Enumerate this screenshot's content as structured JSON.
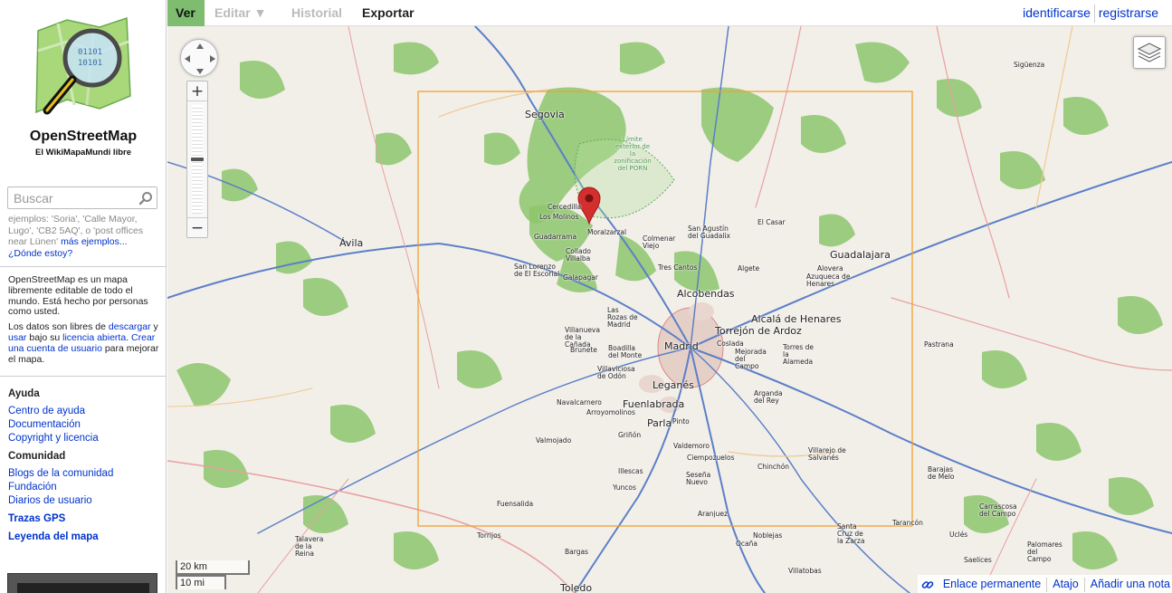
{
  "sidebar": {
    "site_title": "OpenStreetMap",
    "site_subtitle": "El WikiMapaMundi libre",
    "search": {
      "placeholder": "Buscar",
      "examples_prefix": "ejemplos: 'Soria', 'Calle Mayor, Lugo', 'CB2 5AQ', o 'post offices near Lünen'",
      "more_examples": "más ejemplos...",
      "where_am_i": "¿Dónde estoy?"
    },
    "about": {
      "p1": "OpenStreetMap es un mapa libremente editable de todo el mundo. Está hecho por personas como usted.",
      "p2_a": "Los datos son libres de ",
      "p2_download": "descargar",
      "p2_b": " y ",
      "p2_use": "usar",
      "p2_c": " bajo su ",
      "p2_license": "licencia abierta",
      "p2_d": ". ",
      "p2_create": "Crear una cuenta de usuario",
      "p2_e": " para mejorar el mapa."
    },
    "help": {
      "title": "Ayuda",
      "links": [
        "Centro de ayuda",
        "Documentación",
        "Copyright y licencia"
      ]
    },
    "community": {
      "title": "Comunidad",
      "links": [
        "Blogs de la comunidad",
        "Fundación",
        "Diarios de usuario"
      ]
    },
    "gps_traces": "Trazas GPS",
    "map_key": "Leyenda del mapa"
  },
  "topbar": {
    "tabs": [
      "Ver",
      "Editar ▼",
      "Historial",
      "Exportar"
    ],
    "login": "identificarse",
    "signup": "registrarse"
  },
  "map": {
    "scale_km": "20 km",
    "scale_mi": "10 mi",
    "footer": {
      "permalink": "Enlace permanente",
      "shortlink": "Atajo",
      "add_note": "Añadir una nota"
    },
    "labels": {
      "segovia": "Segovia",
      "avila": "Ávila",
      "guadalajara": "Guadalajara",
      "madrid": "Madrid",
      "alcobendas": "Alcobendas",
      "alcala": "Alcalá de Henares",
      "torrejon": "Torrejón de Ardoz",
      "leganes": "Leganés",
      "fuenlabrada": "Fuenlabrada",
      "parla": "Parla",
      "toledo": "Toledo",
      "siguenza": "Sigüenza",
      "cercedilla": "Cercedilla",
      "los_molinos": "Los Molinos",
      "guadarrama": "Guadarrama",
      "moralzarzal": "Moralzarzal",
      "collado_villalba": "Collado Villalba",
      "galapagar": "Galapagar",
      "san_lorenzo": "San Lorenzo de El Escorial",
      "colmenar_viejo": "Colmenar Viejo",
      "san_agustin": "San Agustín del Guadalix",
      "tres_cantos": "Tres Cantos",
      "el_casar": "El Casar",
      "algete": "Algete",
      "alovera": "Alovera",
      "azuqueca": "Azuqueca de Henares",
      "las_rozas": "Las Rozas de Madrid",
      "villanueva": "Villanueva de la Cañada",
      "brunete": "Brunete",
      "boadilla": "Boadilla del Monte",
      "villaviciosa": "Villaviciosa de Odón",
      "coslada": "Coslada",
      "mejorada": "Mejorada del Campo",
      "torres_alameda": "Torres de la Alameda",
      "pastrana": "Pastrana",
      "navalcarnero": "Navalcarnero",
      "arroyomolinos": "Arroyomolinos",
      "pinto": "Pinto",
      "arganda": "Arganda del Rey",
      "griñon": "Griñón",
      "valmojado": "Valmojado",
      "valdemoro": "Valdemoro",
      "ciempozuelos": "Ciempozuelos",
      "chinchon": "Chinchón",
      "villarejo": "Villarejo de Salvanés",
      "barajas_melo": "Barajas de Melo",
      "illescas": "Illescas",
      "seseña": "Seseña Nuevo",
      "yuncos": "Yuncos",
      "fuensalida": "Fuensalida",
      "aranjuez": "Aranjuez",
      "carrascosa": "Carrascosa del Campo",
      "tarancon": "Tarancón",
      "ucles": "Uclés",
      "saelices": "Saelices",
      "palomares": "Palomares del Campo",
      "torrijos": "Torrijos",
      "talavera": "Talavera de la Reina",
      "bargas": "Bargas",
      "ocaña": "Ocaña",
      "noblejas": "Noblejas",
      "santa_cruz": "Santa Cruz de la Zarza",
      "villatobas": "Villatobas",
      "porn": "Límite exterior de la zonificación del PORN"
    }
  },
  "colors": {
    "accent_tab": "#7ebc6f",
    "link": "#0033cc",
    "forest": "#8dc56c",
    "map_bg": "#f2efe9",
    "selection_box": "#f0a030",
    "marker": "#d32f2f"
  }
}
